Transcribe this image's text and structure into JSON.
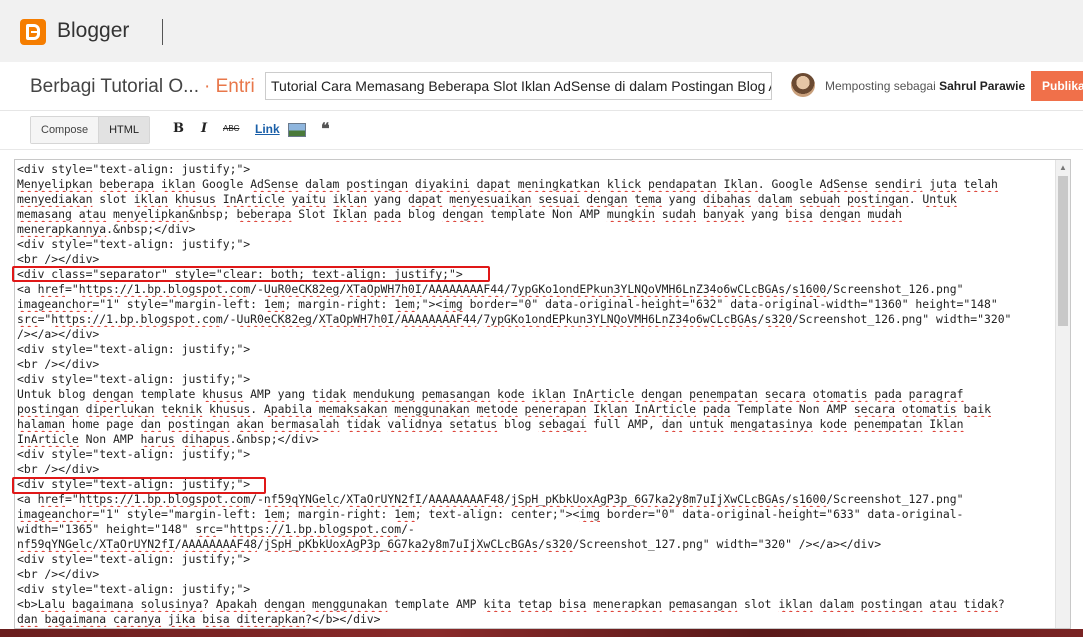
{
  "app": {
    "name": "Blogger",
    "logo_icon": "blogger-logo-icon",
    "brand_color": "#f57d00"
  },
  "post_header": {
    "blog_title": "Berbagi Tutorial O...",
    "entry_label": "· Entri",
    "post_title_value": "Tutorial Cara Memasang Beberapa Slot Iklan AdSense di dalam Postingan Blog AMP",
    "posting_as_prefix": "Memposting sebagai",
    "author_name": "Sahrul Parawie",
    "publish_label": "Publikasikan",
    "publish_color": "#f0704a"
  },
  "toolbar": {
    "compose_label": "Compose",
    "html_label": "HTML",
    "active_mode": "HTML",
    "bold_glyph": "B",
    "italic_glyph": "I",
    "strike_glyph": "ABC",
    "link_label": "Link",
    "quote_glyph": "❝"
  },
  "editor": {
    "lines": [
      [
        {
          "t": "<div style=\"text-align: justify;\">"
        }
      ],
      [
        {
          "t": "Menyelipkan",
          "s": 1
        },
        {
          "t": " "
        },
        {
          "t": "beberapa",
          "s": 1
        },
        {
          "t": " "
        },
        {
          "t": "iklan",
          "s": 1
        },
        {
          "t": " Google "
        },
        {
          "t": "AdSense",
          "s": 1
        },
        {
          "t": " "
        },
        {
          "t": "dalam",
          "s": 1
        },
        {
          "t": " "
        },
        {
          "t": "postingan",
          "s": 1
        },
        {
          "t": " "
        },
        {
          "t": "diyakini",
          "s": 1
        },
        {
          "t": " "
        },
        {
          "t": "dapat",
          "s": 1
        },
        {
          "t": " "
        },
        {
          "t": "meningkatkan",
          "s": 1
        },
        {
          "t": " "
        },
        {
          "t": "klick",
          "s": 1
        },
        {
          "t": " "
        },
        {
          "t": "pendapatan",
          "s": 1
        },
        {
          "t": " "
        },
        {
          "t": "Iklan",
          "s": 1
        },
        {
          "t": ". Google "
        },
        {
          "t": "AdSense",
          "s": 1
        },
        {
          "t": " "
        },
        {
          "t": "sendiri",
          "s": 1
        },
        {
          "t": " "
        },
        {
          "t": "juta",
          "s": 1
        },
        {
          "t": " "
        },
        {
          "t": "telah",
          "s": 1
        }
      ],
      [
        {
          "t": "menyediakan",
          "s": 1
        },
        {
          "t": " slot "
        },
        {
          "t": "iklan",
          "s": 1
        },
        {
          "t": " "
        },
        {
          "t": "khusus",
          "s": 1
        },
        {
          "t": " "
        },
        {
          "t": "InArticle",
          "s": 1
        },
        {
          "t": " "
        },
        {
          "t": "yaitu",
          "s": 1
        },
        {
          "t": " "
        },
        {
          "t": "iklan",
          "s": 1
        },
        {
          "t": " yang "
        },
        {
          "t": "dapat",
          "s": 1
        },
        {
          "t": " "
        },
        {
          "t": "menyesuaikan",
          "s": 1
        },
        {
          "t": " "
        },
        {
          "t": "sesuai",
          "s": 1
        },
        {
          "t": " "
        },
        {
          "t": "dengan",
          "s": 1
        },
        {
          "t": " "
        },
        {
          "t": "tema",
          "s": 1
        },
        {
          "t": " yang "
        },
        {
          "t": "dibahas",
          "s": 1
        },
        {
          "t": " "
        },
        {
          "t": "dalam",
          "s": 1
        },
        {
          "t": " "
        },
        {
          "t": "sebuah",
          "s": 1
        },
        {
          "t": " "
        },
        {
          "t": "postingan",
          "s": 1
        },
        {
          "t": ". "
        },
        {
          "t": "Untuk",
          "s": 1
        }
      ],
      [
        {
          "t": "memasang",
          "s": 1
        },
        {
          "t": " "
        },
        {
          "t": "atau",
          "s": 1
        },
        {
          "t": " "
        },
        {
          "t": "menyelipkan",
          "s": 1
        },
        {
          "t": "&nbsp; "
        },
        {
          "t": "beberapa",
          "s": 1
        },
        {
          "t": " Slot "
        },
        {
          "t": "Iklan",
          "s": 1
        },
        {
          "t": " "
        },
        {
          "t": "pada",
          "s": 1
        },
        {
          "t": " blog "
        },
        {
          "t": "dengan",
          "s": 1
        },
        {
          "t": " template Non AMP "
        },
        {
          "t": "mungkin",
          "s": 1
        },
        {
          "t": " "
        },
        {
          "t": "sudah",
          "s": 1
        },
        {
          "t": " "
        },
        {
          "t": "banyak",
          "s": 1
        },
        {
          "t": " yang "
        },
        {
          "t": "bisa",
          "s": 1
        },
        {
          "t": " "
        },
        {
          "t": "dengan",
          "s": 1
        },
        {
          "t": " "
        },
        {
          "t": "mudah",
          "s": 1
        }
      ],
      [
        {
          "t": "menerapkannya",
          "s": 1
        },
        {
          "t": ".&nbsp;</div>"
        }
      ],
      [
        {
          "t": "<div style=\"text-align: justify;\">"
        }
      ],
      [
        {
          "t": "<br /></div>"
        }
      ],
      [
        {
          "t": "<div class=\"separator\" style=\"clear: both; text-align: justify;\">"
        }
      ],
      [
        {
          "t": "<a "
        },
        {
          "t": "href",
          "s": 1
        },
        {
          "t": "=\""
        },
        {
          "t": "https://1.bp.blogspot.com",
          "s": 1
        },
        {
          "t": "/-"
        },
        {
          "t": "UuR0eCK82eg",
          "s": 1
        },
        {
          "t": "/"
        },
        {
          "t": "XTaOpWH7h0I",
          "s": 1
        },
        {
          "t": "/"
        },
        {
          "t": "AAAAAAAAF44",
          "s": 1
        },
        {
          "t": "/"
        },
        {
          "t": "7ypGKo1ondEPkun3YLNQoVMH6LnZ34o6wCLcBGAs",
          "s": 1
        },
        {
          "t": "/"
        },
        {
          "t": "s1600",
          "s": 1
        },
        {
          "t": "/Screenshot_126.png\""
        }
      ],
      [
        {
          "t": "imageanchor",
          "s": 1
        },
        {
          "t": "=\"1\" style=\"margin-left: "
        },
        {
          "t": "1em",
          "s": 1
        },
        {
          "t": "; margin-right: "
        },
        {
          "t": "1em",
          "s": 1
        },
        {
          "t": ";\"><"
        },
        {
          "t": "img",
          "s": 1
        },
        {
          "t": " border=\"0\" data-original-height=\"632\" data-original-width=\"1360\" height=\"148\""
        }
      ],
      [
        {
          "t": "src",
          "s": 1
        },
        {
          "t": "=\""
        },
        {
          "t": "https://1.bp.blogspot.com",
          "s": 1
        },
        {
          "t": "/-"
        },
        {
          "t": "UuR0eCK82eg",
          "s": 1
        },
        {
          "t": "/"
        },
        {
          "t": "XTaOpWH7h0I",
          "s": 1
        },
        {
          "t": "/"
        },
        {
          "t": "AAAAAAAAF44",
          "s": 1
        },
        {
          "t": "/"
        },
        {
          "t": "7ypGKo1ondEPkun3YLNQoVMH6LnZ34o6wCLcBGAs",
          "s": 1
        },
        {
          "t": "/"
        },
        {
          "t": "s320",
          "s": 1
        },
        {
          "t": "/Screenshot_126.png\" width=\"320\""
        }
      ],
      [
        {
          "t": "/></a></div>"
        }
      ],
      [
        {
          "t": "<div style=\"text-align: justify;\">"
        }
      ],
      [
        {
          "t": "<br /></div>"
        }
      ],
      [
        {
          "t": "<div style=\"text-align: justify;\">"
        }
      ],
      [
        {
          "t": "Untuk blog "
        },
        {
          "t": "dengan",
          "s": 1
        },
        {
          "t": " template "
        },
        {
          "t": "khusus",
          "s": 1
        },
        {
          "t": " AMP yang "
        },
        {
          "t": "tidak",
          "s": 1
        },
        {
          "t": " "
        },
        {
          "t": "mendukung",
          "s": 1
        },
        {
          "t": " "
        },
        {
          "t": "pemasangan",
          "s": 1
        },
        {
          "t": " "
        },
        {
          "t": "kode",
          "s": 1
        },
        {
          "t": " "
        },
        {
          "t": "iklan",
          "s": 1
        },
        {
          "t": " "
        },
        {
          "t": "InArticle",
          "s": 1
        },
        {
          "t": " "
        },
        {
          "t": "dengan",
          "s": 1
        },
        {
          "t": " "
        },
        {
          "t": "penempatan",
          "s": 1
        },
        {
          "t": " "
        },
        {
          "t": "secara",
          "s": 1
        },
        {
          "t": " "
        },
        {
          "t": "otomatis",
          "s": 1
        },
        {
          "t": " "
        },
        {
          "t": "pada",
          "s": 1
        },
        {
          "t": " "
        },
        {
          "t": "paragraf",
          "s": 1
        }
      ],
      [
        {
          "t": "postingan",
          "s": 1
        },
        {
          "t": " "
        },
        {
          "t": "diperlukan",
          "s": 1
        },
        {
          "t": " "
        },
        {
          "t": "teknik",
          "s": 1
        },
        {
          "t": " "
        },
        {
          "t": "khusus",
          "s": 1
        },
        {
          "t": ". "
        },
        {
          "t": "Apabila",
          "s": 1
        },
        {
          "t": " "
        },
        {
          "t": "memaksakan",
          "s": 1
        },
        {
          "t": " "
        },
        {
          "t": "menggunakan",
          "s": 1
        },
        {
          "t": " "
        },
        {
          "t": "metode",
          "s": 1
        },
        {
          "t": " "
        },
        {
          "t": "penerapan",
          "s": 1
        },
        {
          "t": " "
        },
        {
          "t": "Iklan",
          "s": 1
        },
        {
          "t": " "
        },
        {
          "t": "InArticle",
          "s": 1
        },
        {
          "t": " "
        },
        {
          "t": "pada",
          "s": 1
        },
        {
          "t": " Template Non AMP "
        },
        {
          "t": "secara",
          "s": 1
        },
        {
          "t": " "
        },
        {
          "t": "otomatis",
          "s": 1
        },
        {
          "t": " "
        },
        {
          "t": "baik",
          "s": 1
        }
      ],
      [
        {
          "t": "halaman",
          "s": 1
        },
        {
          "t": " home page "
        },
        {
          "t": "dan",
          "s": 1
        },
        {
          "t": " "
        },
        {
          "t": "postingan",
          "s": 1
        },
        {
          "t": " "
        },
        {
          "t": "akan",
          "s": 1
        },
        {
          "t": " "
        },
        {
          "t": "bermasalah",
          "s": 1
        },
        {
          "t": " "
        },
        {
          "t": "tidak",
          "s": 1
        },
        {
          "t": " "
        },
        {
          "t": "validnya",
          "s": 1
        },
        {
          "t": " "
        },
        {
          "t": "setatus",
          "s": 1
        },
        {
          "t": " blog "
        },
        {
          "t": "sebagai",
          "s": 1
        },
        {
          "t": " full AMP, "
        },
        {
          "t": "dan",
          "s": 1
        },
        {
          "t": " "
        },
        {
          "t": "untuk",
          "s": 1
        },
        {
          "t": " "
        },
        {
          "t": "mengatasinya",
          "s": 1
        },
        {
          "t": " "
        },
        {
          "t": "kode",
          "s": 1
        },
        {
          "t": " "
        },
        {
          "t": "penempatan",
          "s": 1
        },
        {
          "t": " "
        },
        {
          "t": "Iklan",
          "s": 1
        }
      ],
      [
        {
          "t": "InArticle",
          "s": 1
        },
        {
          "t": " Non AMP "
        },
        {
          "t": "harus",
          "s": 1
        },
        {
          "t": " "
        },
        {
          "t": "dihapus",
          "s": 1
        },
        {
          "t": ".&nbsp;</div>"
        }
      ],
      [
        {
          "t": "<div style=\"text-align: justify;\">"
        }
      ],
      [
        {
          "t": "<br /></div>"
        }
      ],
      [
        {
          "t": "<div style=\"text-align: justify;\">"
        }
      ],
      [
        {
          "t": "<a "
        },
        {
          "t": "href",
          "s": 1
        },
        {
          "t": "=\""
        },
        {
          "t": "https://1.bp.blogspot.com",
          "s": 1
        },
        {
          "t": "/-"
        },
        {
          "t": "nf59qYNGelc",
          "s": 1
        },
        {
          "t": "/"
        },
        {
          "t": "XTaOrUYN2fI",
          "s": 1
        },
        {
          "t": "/"
        },
        {
          "t": "AAAAAAAAF48",
          "s": 1
        },
        {
          "t": "/"
        },
        {
          "t": "jSpH_pKbkUoxAgP3p_6G7ka2y8m7uIjXwCLcBGAs",
          "s": 1
        },
        {
          "t": "/"
        },
        {
          "t": "s1600",
          "s": 1
        },
        {
          "t": "/Screenshot_127.png\""
        }
      ],
      [
        {
          "t": "imageanchor",
          "s": 1
        },
        {
          "t": "=\"1\" style=\"margin-left: "
        },
        {
          "t": "1em",
          "s": 1
        },
        {
          "t": "; margin-right: "
        },
        {
          "t": "1em",
          "s": 1
        },
        {
          "t": "; text-align: center;\"><"
        },
        {
          "t": "img",
          "s": 1
        },
        {
          "t": " border=\"0\" data-original-height=\"633\" data-original-"
        }
      ],
      [
        {
          "t": "width=\"1365\" height=\"148\" "
        },
        {
          "t": "src",
          "s": 1
        },
        {
          "t": "=\""
        },
        {
          "t": "https://1.bp.blogspot.com",
          "s": 1
        },
        {
          "t": "/-"
        }
      ],
      [
        {
          "t": "nf59qYNGelc",
          "s": 1
        },
        {
          "t": "/"
        },
        {
          "t": "XTaOrUYN2fI",
          "s": 1
        },
        {
          "t": "/"
        },
        {
          "t": "AAAAAAAAF48",
          "s": 1
        },
        {
          "t": "/"
        },
        {
          "t": "jSpH_pKbkUoxAgP3p_6G7ka2y8m7uIjXwCLcBGAs",
          "s": 1
        },
        {
          "t": "/"
        },
        {
          "t": "s320",
          "s": 1
        },
        {
          "t": "/Screenshot_127.png\" width=\"320\" /></a></div>"
        }
      ],
      [
        {
          "t": "<div style=\"text-align: justify;\">"
        }
      ],
      [
        {
          "t": "<br /></div>"
        }
      ],
      [
        {
          "t": "<div style=\"text-align: justify;\">"
        }
      ],
      [
        {
          "t": "<b>"
        },
        {
          "t": "Lalu",
          "s": 1
        },
        {
          "t": " "
        },
        {
          "t": "bagaimana",
          "s": 1
        },
        {
          "t": " "
        },
        {
          "t": "solusinya",
          "s": 1
        },
        {
          "t": "? "
        },
        {
          "t": "Apakah",
          "s": 1
        },
        {
          "t": " "
        },
        {
          "t": "dengan",
          "s": 1
        },
        {
          "t": " "
        },
        {
          "t": "menggunakan",
          "s": 1
        },
        {
          "t": " template AMP "
        },
        {
          "t": "kita",
          "s": 1
        },
        {
          "t": " "
        },
        {
          "t": "tetap",
          "s": 1
        },
        {
          "t": " "
        },
        {
          "t": "bisa",
          "s": 1
        },
        {
          "t": " "
        },
        {
          "t": "menerapkan",
          "s": 1
        },
        {
          "t": " "
        },
        {
          "t": "pemasangan",
          "s": 1
        },
        {
          "t": " slot "
        },
        {
          "t": "iklan",
          "s": 1
        },
        {
          "t": " "
        },
        {
          "t": "dalam",
          "s": 1
        },
        {
          "t": " "
        },
        {
          "t": "postingan",
          "s": 1
        },
        {
          "t": " "
        },
        {
          "t": "atau",
          "s": 1
        },
        {
          "t": " "
        },
        {
          "t": "tidak",
          "s": 1
        },
        {
          "t": "?"
        }
      ],
      [
        {
          "t": "dan",
          "s": 1
        },
        {
          "t": " "
        },
        {
          "t": "bagaimana",
          "s": 1
        },
        {
          "t": " "
        },
        {
          "t": "caranya",
          "s": 1
        },
        {
          "t": " "
        },
        {
          "t": "jika",
          "s": 1
        },
        {
          "t": " "
        },
        {
          "t": "bisa",
          "s": 1
        },
        {
          "t": " "
        },
        {
          "t": "diterapkan",
          "s": 1
        },
        {
          "t": "?</b></div>"
        }
      ]
    ],
    "highlight_color": "#e01818",
    "squiggle_color": "#d93025"
  }
}
